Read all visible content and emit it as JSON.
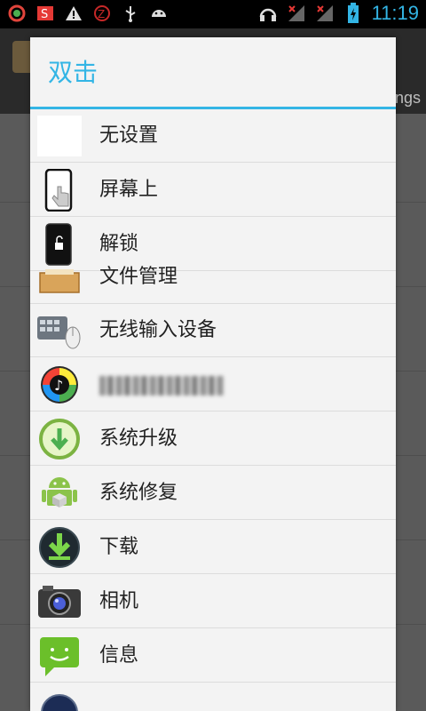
{
  "status_bar": {
    "time": "11:19",
    "left_icons": [
      "app-circle-icon",
      "s-app-icon",
      "warning-icon",
      "z-app-icon",
      "usb-icon",
      "android-debug-icon"
    ],
    "right_icons": [
      "headset-icon",
      "signal-no-service-icon",
      "signal-no-service-icon",
      "battery-charging-icon"
    ]
  },
  "background_app": {
    "title_fragment": "ngs"
  },
  "dialog": {
    "title": "双击",
    "items": [
      {
        "label": "无设置",
        "icon": "blank-icon"
      },
      {
        "label": "屏幕上",
        "icon": "screen-touch-icon"
      },
      {
        "label": "解锁",
        "icon": "unlock-phone-icon"
      },
      {
        "label": "文件管理",
        "icon": "file-manager-icon"
      },
      {
        "label": "无线输入设备",
        "icon": "wireless-input-icon"
      },
      {
        "label": "",
        "icon": "music-player-icon"
      },
      {
        "label": "系统升级",
        "icon": "system-update-icon"
      },
      {
        "label": "系统修复",
        "icon": "system-repair-icon"
      },
      {
        "label": "下载",
        "icon": "download-icon"
      },
      {
        "label": "相机",
        "icon": "camera-icon"
      },
      {
        "label": "信息",
        "icon": "messaging-icon"
      }
    ]
  },
  "colors": {
    "accent": "#33b5e5",
    "dialog_bg": "#f3f3f3",
    "divider": "#dcdcdc"
  }
}
